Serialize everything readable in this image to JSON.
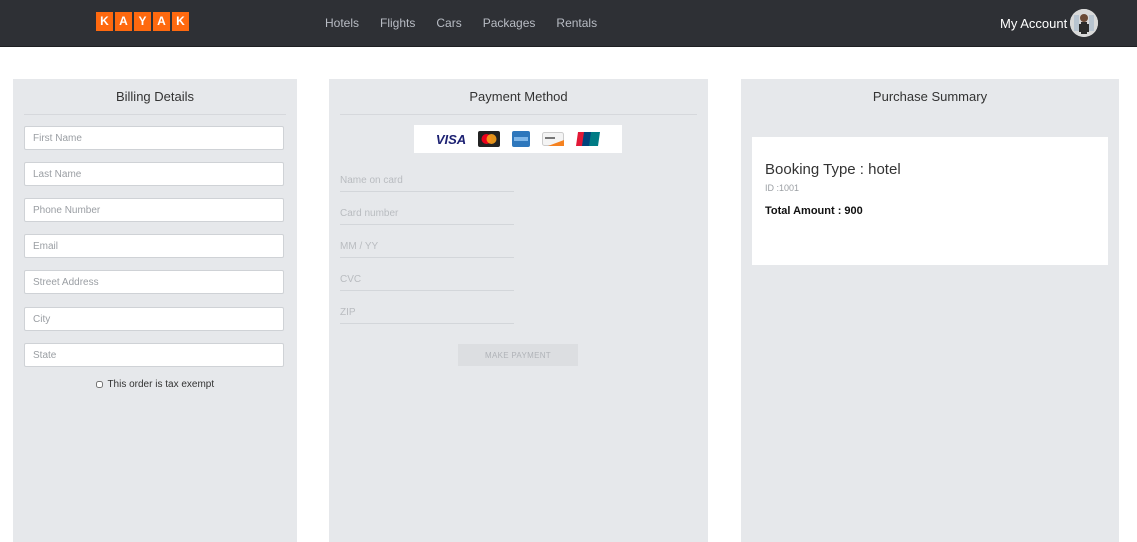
{
  "brand": {
    "logo_letters": [
      "K",
      "A",
      "Y",
      "A",
      "K"
    ],
    "logo_color": "#ff690f"
  },
  "nav": {
    "links": [
      "Hotels",
      "Flights",
      "Cars",
      "Packages",
      "Rentals"
    ],
    "account_label": "My Account"
  },
  "billing": {
    "title": "Billing Details",
    "fields": [
      {
        "placeholder": "First Name",
        "value": ""
      },
      {
        "placeholder": "Last Name",
        "value": ""
      },
      {
        "placeholder": "Phone Number",
        "value": ""
      },
      {
        "placeholder": "Email",
        "value": ""
      },
      {
        "placeholder": "Street Address",
        "value": ""
      },
      {
        "placeholder": "City",
        "value": ""
      },
      {
        "placeholder": "State",
        "value": ""
      }
    ],
    "tax_exempt_label": "This order is tax exempt",
    "tax_exempt_checked": false
  },
  "payment": {
    "title": "Payment Method",
    "card_logos": [
      "visa-icon",
      "mastercard-icon",
      "amex-icon",
      "discover-icon",
      "unionpay-icon"
    ],
    "visa_text": "VISA",
    "fields": [
      {
        "placeholder": "Name on card",
        "value": ""
      },
      {
        "placeholder": "Card number",
        "value": ""
      },
      {
        "placeholder": "MM / YY",
        "value": ""
      },
      {
        "placeholder": "CVC",
        "value": ""
      },
      {
        "placeholder": "ZIP",
        "value": ""
      }
    ],
    "submit_label": "MAKE PAYMENT"
  },
  "summary": {
    "title": "Purchase Summary",
    "booking_type": "Booking Type : hotel",
    "booking_id": "ID :1001",
    "total": "Total Amount : 900"
  }
}
